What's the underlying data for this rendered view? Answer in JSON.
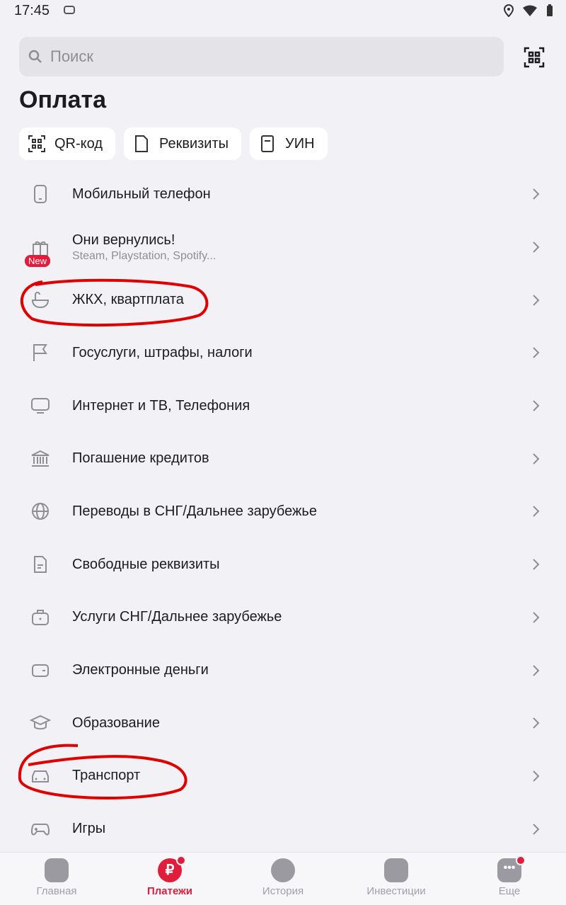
{
  "status": {
    "time": "17:45",
    "app_badge": "ઊ"
  },
  "search": {
    "placeholder": "Поиск"
  },
  "page": {
    "title": "Оплата"
  },
  "chips": [
    {
      "label": "QR-код",
      "icon": "qr-icon"
    },
    {
      "label": "Реквизиты",
      "icon": "document-icon"
    },
    {
      "label": "УИН",
      "icon": "receipt-icon"
    }
  ],
  "items": [
    {
      "title": "Мобильный телефон",
      "icon": "phone-icon"
    },
    {
      "title": "Они вернулись!",
      "subtitle": "Steam, Playstation, Spotify...",
      "icon": "gift-icon",
      "badge": "New"
    },
    {
      "title": "ЖКХ, квартплата",
      "icon": "bath-icon"
    },
    {
      "title": "Госуслуги, штрафы, налоги",
      "icon": "flag-icon"
    },
    {
      "title": "Интернет и ТВ, Телефония",
      "icon": "tv-icon"
    },
    {
      "title": "Погашение кредитов",
      "icon": "bank-icon"
    },
    {
      "title": "Переводы в СНГ/Дальнее зарубежье",
      "icon": "globe-icon"
    },
    {
      "title": "Свободные реквизиты",
      "icon": "doc-icon"
    },
    {
      "title": "Услуги СНГ/Дальнее зарубежье",
      "icon": "briefcase-icon"
    },
    {
      "title": "Электронные деньги",
      "icon": "wallet-icon"
    },
    {
      "title": "Образование",
      "icon": "graduation-icon"
    },
    {
      "title": "Транспорт",
      "icon": "car-icon"
    },
    {
      "title": "Игры",
      "icon": "gamepad-icon"
    }
  ],
  "tabs": [
    {
      "label": "Главная",
      "icon": "home-icon"
    },
    {
      "label": "Платежи",
      "icon": "ruble-icon",
      "active": true
    },
    {
      "label": "История",
      "icon": "clock-icon"
    },
    {
      "label": "Инвестиции",
      "icon": "chart-icon"
    },
    {
      "label": "Еще",
      "icon": "more-icon"
    }
  ],
  "colors": {
    "accent": "#e01e3c",
    "annotation": "#e00000",
    "bg": "#f2f2f6"
  }
}
